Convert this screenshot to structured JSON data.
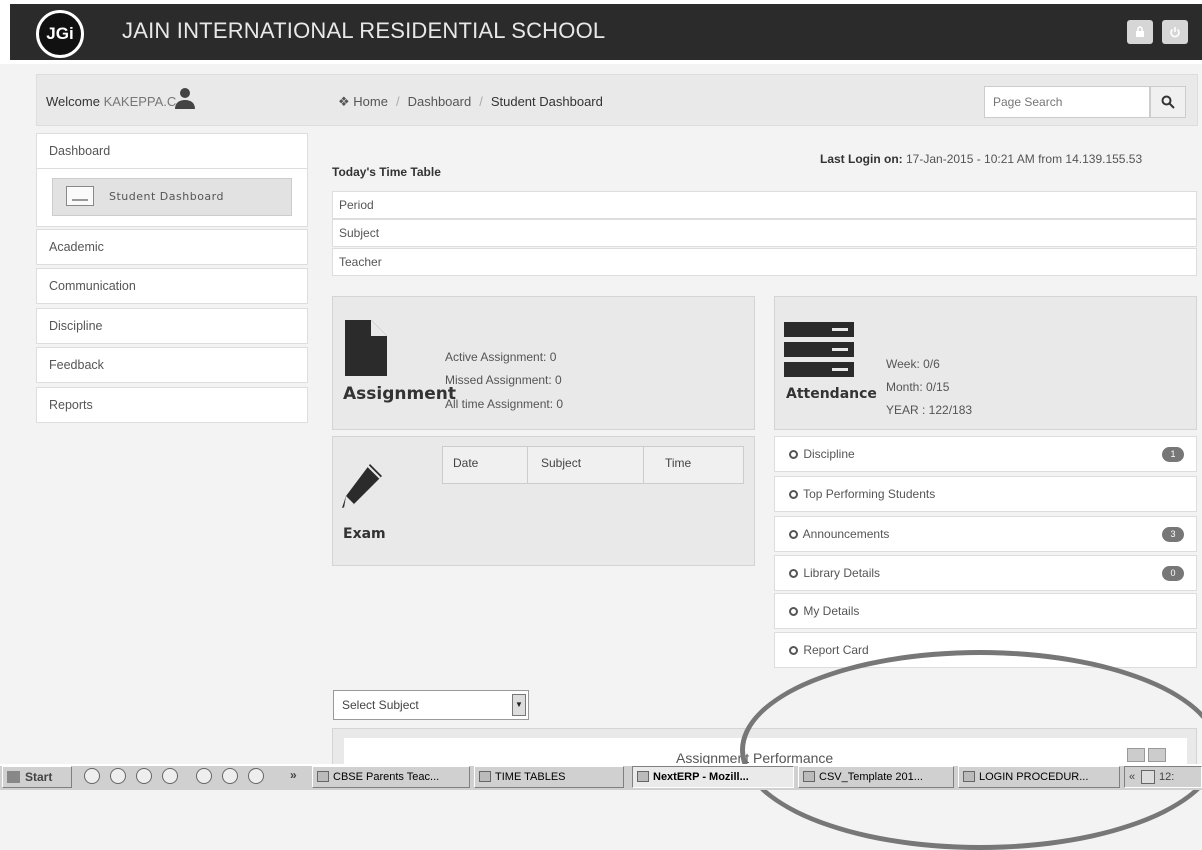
{
  "header": {
    "logo_text": "JGi",
    "school_name": "JAIN INTERNATIONAL RESIDENTIAL SCHOOL",
    "lock_icon": "lock-icon",
    "power_icon": "power-icon"
  },
  "welcome": {
    "label": "Welcome",
    "user": "KAKEPPA.C"
  },
  "breadcrumb": {
    "home": "Home",
    "dashboard": "Dashboard",
    "current": "Student Dashboard"
  },
  "search": {
    "placeholder": "Page Search"
  },
  "sidebar": {
    "items": [
      {
        "label": "Dashboard"
      },
      {
        "label": "Academic"
      },
      {
        "label": "Communication"
      },
      {
        "label": "Discipline"
      },
      {
        "label": "Feedback"
      },
      {
        "label": "Reports"
      }
    ],
    "sub_item": "Student Dashboard"
  },
  "timetable": {
    "title": "Today's Time Table",
    "rows": [
      "Period",
      "Subject",
      "Teacher"
    ]
  },
  "last_login": {
    "label": "Last Login on:",
    "value": "17-Jan-2015 - 10:21 AM from 14.139.155.53"
  },
  "assignment": {
    "title": "Assignment",
    "active": "Active Assignment: 0",
    "missed": "Missed Assignment: 0",
    "alltime": "All time Assignment: 0"
  },
  "attendance": {
    "title": "Attendance",
    "week": "Week: 0/6",
    "month": "Month: 0/15",
    "year": "YEAR : 122/183"
  },
  "exam": {
    "title": "Exam",
    "columns": [
      "Date",
      "Subject",
      "Time"
    ]
  },
  "right_list": [
    {
      "label": "Discipline",
      "badge": "1"
    },
    {
      "label": "Top Performing Students",
      "badge": ""
    },
    {
      "label": "Announcements",
      "badge": "3"
    },
    {
      "label": "Library Details",
      "badge": "0"
    },
    {
      "label": "My Details",
      "badge": ""
    },
    {
      "label": "Report Card",
      "badge": ""
    }
  ],
  "select_subject": "Select Subject",
  "assignment_performance": "Assignment Performance",
  "taskbar": {
    "start": "Start",
    "buttons": [
      "CBSE Parents Teac...",
      "TIME TABLES",
      "NextERP - Mozill...",
      "CSV_Template 201...",
      "LOGIN PROCEDUR..."
    ],
    "chevron": "»",
    "tray_chevron": "«",
    "clock": "12:"
  },
  "colors": {
    "topbar": "#2b2b2b",
    "panel": "#e9e9e9",
    "annotation_circle": "#777777"
  }
}
